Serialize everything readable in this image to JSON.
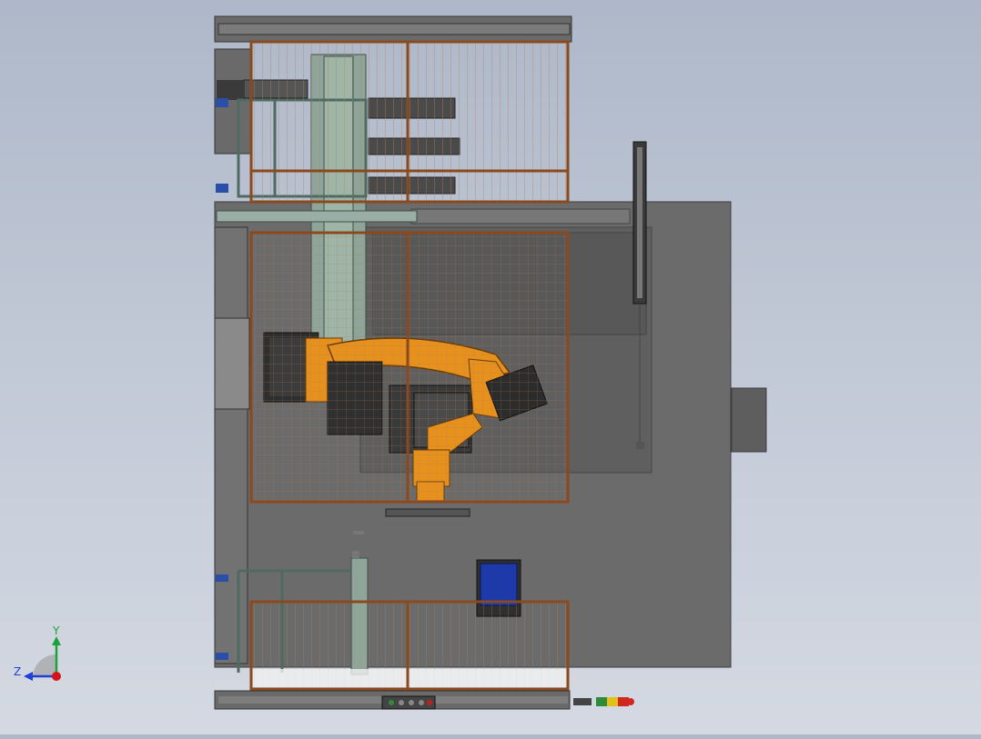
{
  "viewport": {
    "background_top": "#aeb8c9",
    "background_bottom": "#d4d9e2"
  },
  "triad": {
    "y_label": "Y",
    "z_label": "Z",
    "y_color": "#1aa33a",
    "z_color": "#1f3fd6",
    "x_color": "#d8121b"
  },
  "colors": {
    "base_plate": "#6e6e6e",
    "fence_frame": "#8a4a1e",
    "fence_mesh": "#c0895a",
    "robot": "#e6901e",
    "robot_dark": "#3a3a3a",
    "steel": "#8faaa0",
    "control_screen": "#1e3aa8",
    "stack_light": [
      "#2e8b3a",
      "#e0c21a",
      "#d0281e"
    ]
  }
}
